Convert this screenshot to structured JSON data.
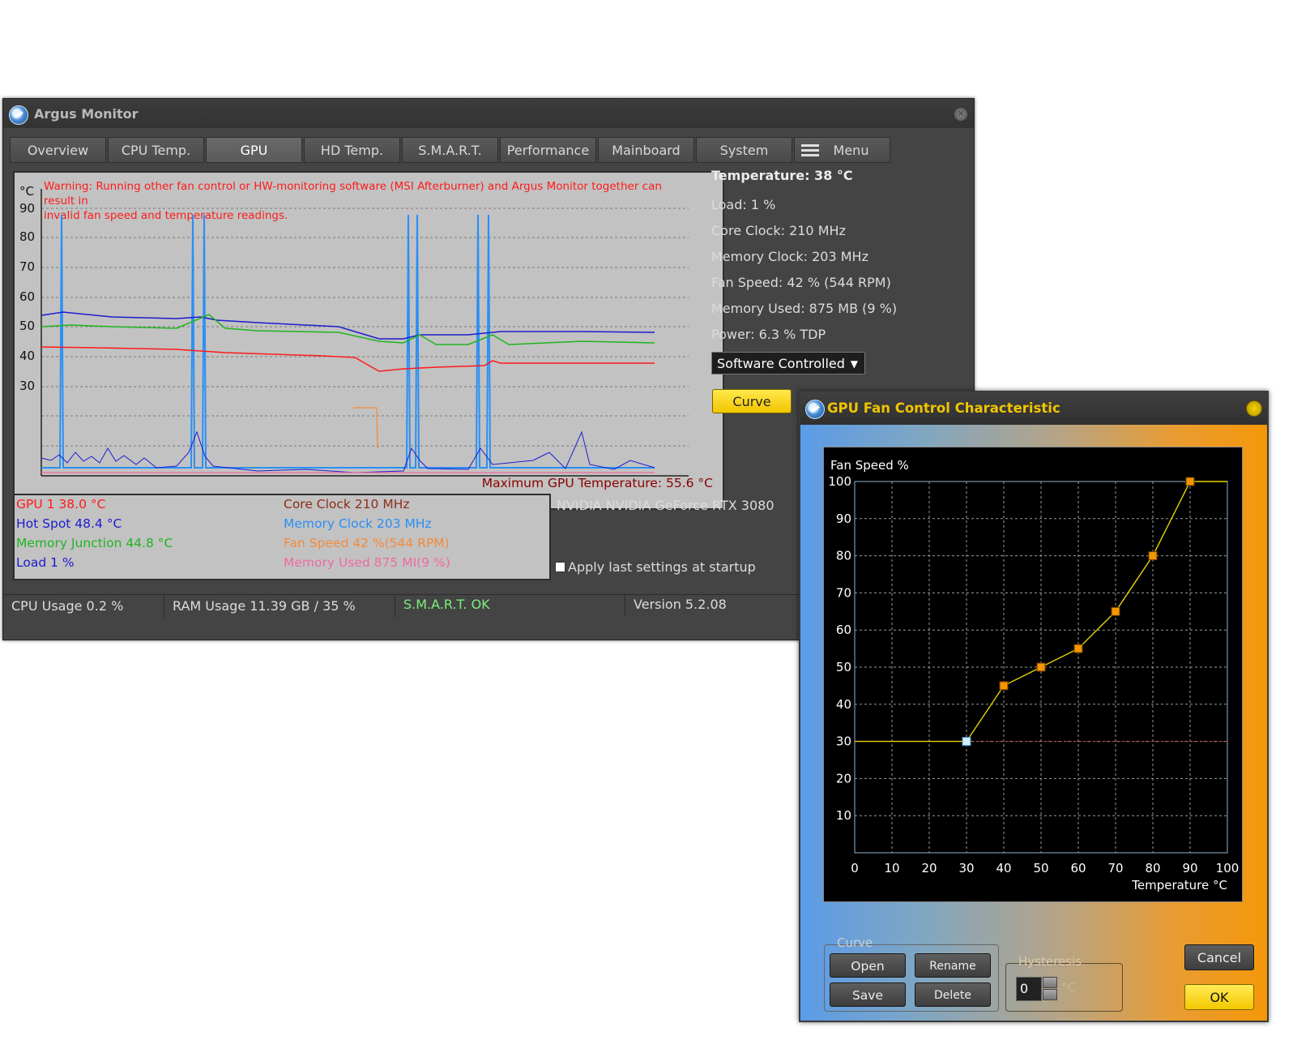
{
  "main_window": {
    "title": "Argus Monitor",
    "tabs": [
      "Overview",
      "CPU Temp.",
      "GPU",
      "HD Temp.",
      "S.M.A.R.T.",
      "Performance",
      "Mainboard",
      "System",
      "Menu"
    ],
    "active_tab": "GPU",
    "warning_line1": "Warning: Running other fan control or HW-monitoring software (MSI Afterburner) and Argus Monitor together can result in",
    "warning_line2": "invalid fan speed and temperature readings.",
    "unit": "°C",
    "y_ticks": [
      "90",
      "80",
      "70",
      "60",
      "50",
      "40",
      "30"
    ],
    "max_temp": "Maximum GPU Temperature: 55.6 °C",
    "info": {
      "temperature": "Temperature: 38 °C",
      "load": "Load: 1 %",
      "core_clock": "Core Clock: 210 MHz",
      "memory_clock": "Memory Clock: 203 MHz",
      "fan_speed": "Fan Speed: 42 % (544 RPM)",
      "memory_used": "Memory Used: 875 MB (9 %)",
      "power": "Power: 6.3 % TDP"
    },
    "fan_mode": "Software Controlled",
    "curve_button": "Curve",
    "legend_left": [
      "GPU 1 38.0 °C",
      "Hot Spot 48.4 °C",
      "Memory Junction 44.8 °C",
      "Load 1 %"
    ],
    "legend_right": [
      "Core Clock 210 MHz",
      "Memory Clock 203 MHz",
      "Fan Speed 42 %(544 RPM)",
      "Memory Used 875 MI(9 %)"
    ],
    "gpu_name": "NVIDIA NVIDIA GeForce RTX 3080",
    "apply_startup": "Apply last settings at startup",
    "status": {
      "cpu_usage": "CPU Usage 0.2 %",
      "ram_usage": "RAM Usage 11.39 GB / 35 %",
      "smart": "S.M.A.R.T. OK",
      "version": "Version 5.2.08"
    },
    "colors": {
      "gpu": "#ff1a1a",
      "hotspot": "#1c1cd0",
      "memjunction": "#1fb51f",
      "load": "#1c1cd0",
      "coreclock": "#8b2e1a",
      "memclock": "#2a8ff5",
      "fanspeed": "#f58a3a",
      "memused": "#f06aa0",
      "smart_ok": "#7cf07c"
    }
  },
  "fan_dialog": {
    "title": "GPU Fan Control Characteristic",
    "curve_group": "Curve",
    "buttons": {
      "open": "Open",
      "rename": "Rename",
      "save": "Save",
      "delete": "Delete",
      "cancel": "Cancel",
      "ok": "OK"
    },
    "hysteresis_group": "Hysteresis",
    "hysteresis_value": "0",
    "hysteresis_unit": "°C"
  },
  "chart_data": {
    "type": "line",
    "title": "",
    "ylabel": "Fan Speed %",
    "xlabel": "Temperature °C",
    "xlim": [
      0,
      100
    ],
    "ylim": [
      0,
      100
    ],
    "x_ticks": [
      0,
      10,
      20,
      30,
      40,
      50,
      60,
      70,
      80,
      90,
      100
    ],
    "y_ticks": [
      10,
      20,
      30,
      40,
      50,
      60,
      70,
      80,
      90,
      100
    ],
    "grid": true,
    "hysteresis_line": 30,
    "series": [
      {
        "x": [
          0,
          30,
          40,
          50,
          60,
          70,
          80,
          90,
          100
        ],
        "y": [
          30,
          30,
          45,
          50,
          55,
          65,
          80,
          100,
          100
        ],
        "points": [
          {
            "x": 30,
            "y": 30
          },
          {
            "x": 40,
            "y": 45
          },
          {
            "x": 50,
            "y": 50
          },
          {
            "x": 60,
            "y": 55
          },
          {
            "x": 70,
            "y": 65
          },
          {
            "x": 80,
            "y": 80
          },
          {
            "x": 90,
            "y": 100
          }
        ]
      }
    ],
    "line_color": "#e6d200",
    "point_color": "#f59600",
    "selected_point_color": "#cfefff"
  }
}
